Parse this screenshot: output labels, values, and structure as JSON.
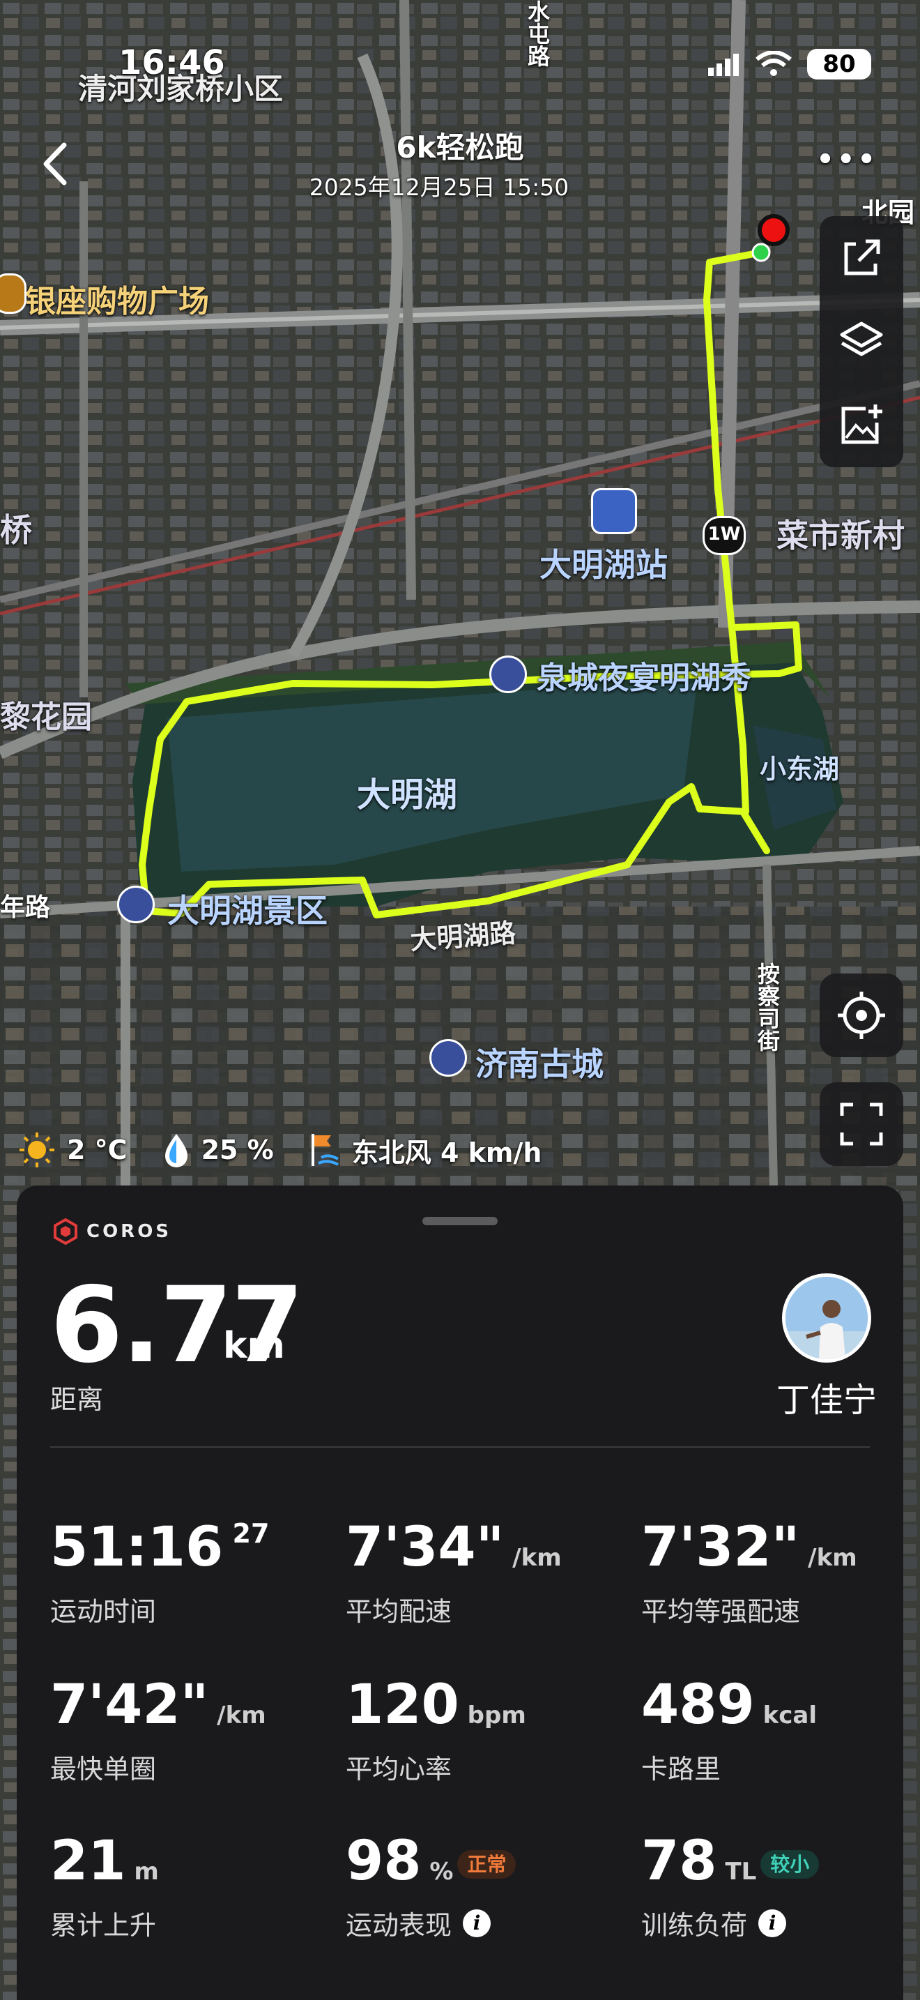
{
  "status_bar": {
    "time": "16:46",
    "battery": "80"
  },
  "header": {
    "title": "6k轻松跑",
    "subtitle": "2025年12月25日 15:50"
  },
  "map": {
    "labels": {
      "neighborhood": "清河刘家桥小区",
      "mall": "银座购物广场",
      "station": "大明湖站",
      "village": "菜市新村",
      "night_show": "泉城夜宴明湖秀",
      "lake": "大明湖",
      "xiaodonghu": "小东湖",
      "scenic": "大明湖景区",
      "road": "大明湖路",
      "old_city": "济南古城",
      "park": "黎花园",
      "bridge": "桥",
      "year_road": "年路",
      "anchasi": "按察司街",
      "shuitun": "水屯路",
      "north_edge": "北园",
      "road_badge": "1W"
    },
    "route_color": "#dcff1c"
  },
  "weather": {
    "temp": "2 °C",
    "humidity": "25 %",
    "wind": "东北风 4 km/h"
  },
  "summary": {
    "brand": "COROS",
    "distance_value": "6.77",
    "distance_unit": "km",
    "distance_label": "距离",
    "user_name": "丁佳宁"
  },
  "metrics": [
    {
      "value": "51:16",
      "sup": "27",
      "unit": "",
      "label": "运动时间"
    },
    {
      "value": "7'34\"",
      "unit": "/km",
      "label": "平均配速"
    },
    {
      "value": "7'32\"",
      "unit": "/km",
      "label": "平均等强配速"
    },
    {
      "value": "7'42\"",
      "unit": "/km",
      "label": "最快单圈"
    },
    {
      "value": "120",
      "unit": "bpm",
      "label": "平均心率"
    },
    {
      "value": "489",
      "unit": "kcal",
      "label": "卡路里"
    },
    {
      "value": "21",
      "unit": "m",
      "label": "累计上升"
    },
    {
      "value": "98",
      "unit": "%",
      "badge": "正常",
      "label": "运动表现",
      "badge_color": "#f07a3a",
      "badge_bg": "#3d2418"
    },
    {
      "value": "78",
      "unit": "TL",
      "badge": "较小",
      "label": "训练负荷",
      "badge_color": "#3fd1b8",
      "badge_bg": "#173a35"
    }
  ]
}
